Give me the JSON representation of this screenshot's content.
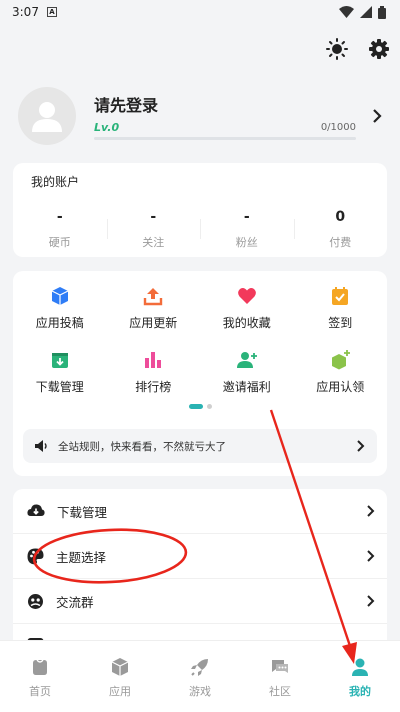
{
  "status": {
    "time": "3:07",
    "sim_label": "A"
  },
  "profile": {
    "title": "请先登录",
    "level": "Lv.0",
    "exp": "0/1000",
    "exp_progress": 0
  },
  "account": {
    "title": "我的账户",
    "stats": [
      {
        "value": "-",
        "label": "硬币"
      },
      {
        "value": "-",
        "label": "关注"
      },
      {
        "value": "-",
        "label": "粉丝"
      },
      {
        "value": "0",
        "label": "付费"
      }
    ]
  },
  "grid": {
    "items": [
      {
        "label": "应用投稿",
        "icon": "cube-icon",
        "color": "#2f7df6"
      },
      {
        "label": "应用更新",
        "icon": "upload-icon",
        "color": "#f36c3a"
      },
      {
        "label": "我的收藏",
        "icon": "heart-icon",
        "color": "#f2395b"
      },
      {
        "label": "签到",
        "icon": "calendar-check-icon",
        "color": "#f5a623"
      },
      {
        "label": "下载管理",
        "icon": "download-box-icon",
        "color": "#2ab37a"
      },
      {
        "label": "排行榜",
        "icon": "bar-chart-icon",
        "color": "#ee4c9a"
      },
      {
        "label": "邀请福利",
        "icon": "add-user-icon",
        "color": "#2ab37a"
      },
      {
        "label": "应用认领",
        "icon": "cube-plus-icon",
        "color": "#8bc34a"
      }
    ]
  },
  "notice": {
    "text": "全站规则，快来看看，不然就亏大了"
  },
  "menu": {
    "items": [
      {
        "label": "下载管理",
        "icon": "cloud-download-icon"
      },
      {
        "label": "主题选择",
        "icon": "palette-icon"
      },
      {
        "label": "交流群",
        "icon": "group-icon"
      }
    ]
  },
  "tabs": [
    {
      "label": "首页",
      "icon": "home-icon"
    },
    {
      "label": "应用",
      "icon": "cube-icon"
    },
    {
      "label": "游戏",
      "icon": "rocket-icon"
    },
    {
      "label": "社区",
      "icon": "chat-icon"
    },
    {
      "label": "我的",
      "icon": "person-icon",
      "active": true
    }
  ],
  "colors": {
    "accent": "#2ab3b3",
    "level": "#2ab37a",
    "annotation": "#e8261c"
  }
}
